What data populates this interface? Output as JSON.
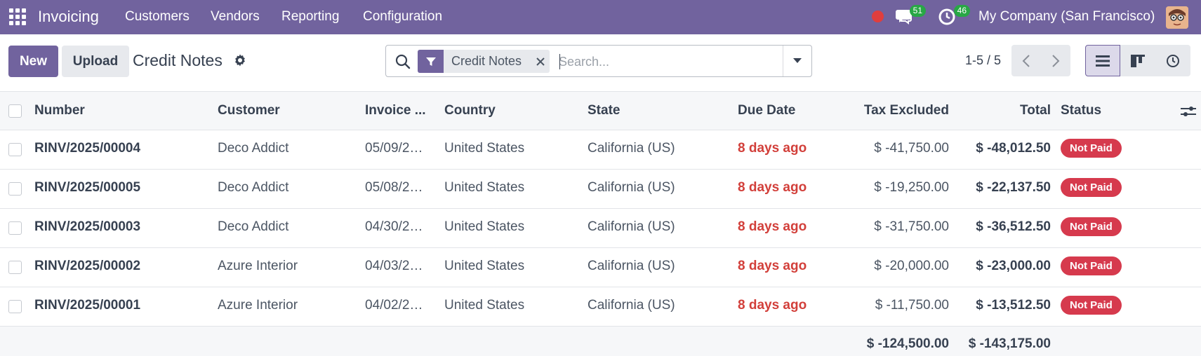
{
  "navbar": {
    "app_name": "Invoicing",
    "menu": [
      "Customers",
      "Vendors",
      "Reporting",
      "Configuration"
    ],
    "messages_count": "51",
    "activities_count": "46",
    "company": "My Company (San Francisco)"
  },
  "control_panel": {
    "new_label": "New",
    "upload_label": "Upload",
    "title": "Credit Notes",
    "search_facet": "Credit Notes",
    "search_placeholder": "Search...",
    "pager": "1-5 / 5"
  },
  "table": {
    "columns": [
      "Number",
      "Customer",
      "Invoice ...",
      "Country",
      "State",
      "Due Date",
      "Tax Excluded",
      "Total",
      "Status"
    ],
    "rows": [
      {
        "number": "RINV/2025/00004",
        "customer": "Deco Addict",
        "invoice_date": "05/09/2…",
        "country": "United States",
        "state": "California (US)",
        "due": "8 days ago",
        "tax_excluded": "$ -41,750.00",
        "total": "$ -48,012.50",
        "status": "Not Paid"
      },
      {
        "number": "RINV/2025/00005",
        "customer": "Deco Addict",
        "invoice_date": "05/08/2…",
        "country": "United States",
        "state": "California (US)",
        "due": "8 days ago",
        "tax_excluded": "$ -19,250.00",
        "total": "$ -22,137.50",
        "status": "Not Paid"
      },
      {
        "number": "RINV/2025/00003",
        "customer": "Deco Addict",
        "invoice_date": "04/30/2…",
        "country": "United States",
        "state": "California (US)",
        "due": "8 days ago",
        "tax_excluded": "$ -31,750.00",
        "total": "$ -36,512.50",
        "status": "Not Paid"
      },
      {
        "number": "RINV/2025/00002",
        "customer": "Azure Interior",
        "invoice_date": "04/03/2…",
        "country": "United States",
        "state": "California (US)",
        "due": "8 days ago",
        "tax_excluded": "$ -20,000.00",
        "total": "$ -23,000.00",
        "status": "Not Paid"
      },
      {
        "number": "RINV/2025/00001",
        "customer": "Azure Interior",
        "invoice_date": "04/02/2…",
        "country": "United States",
        "state": "California (US)",
        "due": "8 days ago",
        "tax_excluded": "$ -11,750.00",
        "total": "$ -13,512.50",
        "status": "Not Paid"
      }
    ],
    "footer": {
      "tax_excluded": "$ -124,500.00",
      "total": "$ -143,175.00"
    }
  },
  "colors": {
    "brand": "#71639e",
    "overdue": "#d23f3a",
    "not_paid": "#d63a4d"
  }
}
